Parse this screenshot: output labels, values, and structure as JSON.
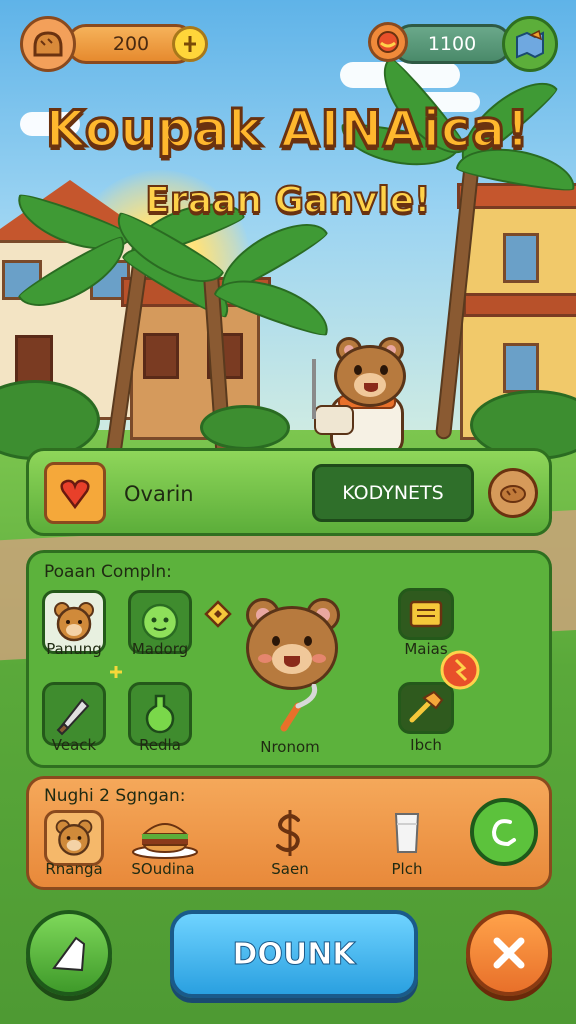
{
  "hud": {
    "left_value": "200",
    "left_action_icon": "plus-coin-icon",
    "right_value": "1100",
    "left_icon": "bread-icon",
    "right_icon": "food-bowl-icon",
    "right_corner_icon": "map-icon"
  },
  "title": {
    "main": "Koupak AINAica!",
    "sub": "Eraan Ganvle!"
  },
  "top_panel": {
    "left_label": "Ovarin",
    "button_label": "KODYNETS",
    "left_icon": "heart-map-icon",
    "right_icon": "bread-loaf-icon"
  },
  "mid_panel": {
    "heading": "Poaan Compln:",
    "items": [
      {
        "label": "Panung",
        "icon": "bear-face-icon"
      },
      {
        "label": "Madorg",
        "icon": "green-slime-icon"
      },
      {
        "label": "Maias",
        "icon": "book-icon"
      },
      {
        "label": "Veack",
        "icon": "knife-icon"
      },
      {
        "label": "Redla",
        "icon": "green-potion-icon"
      },
      {
        "label": "Ibch",
        "icon": "hammer-icon"
      }
    ],
    "center_label": "Nronom"
  },
  "bottom_panel": {
    "heading": "Nughi 2 Sgngan:",
    "items": [
      {
        "label": "Rnanga",
        "icon": "bear-face-icon"
      },
      {
        "label": "SOudina",
        "icon": "burger-icon"
      },
      {
        "label": "Saen",
        "icon": "dollar-coin-icon"
      },
      {
        "label": "Plch",
        "icon": "milk-glass-icon"
      }
    ],
    "action_icon": "refresh-icon"
  },
  "footer": {
    "main_button": "DOUNK",
    "left_icon": "flag-icon",
    "right_icon": "close-icon"
  },
  "colors": {
    "accent_orange": "#e8893a",
    "panel_green": "#5cb23c",
    "button_blue": "#2aa0e0",
    "title_gold": "#ffb82e"
  }
}
